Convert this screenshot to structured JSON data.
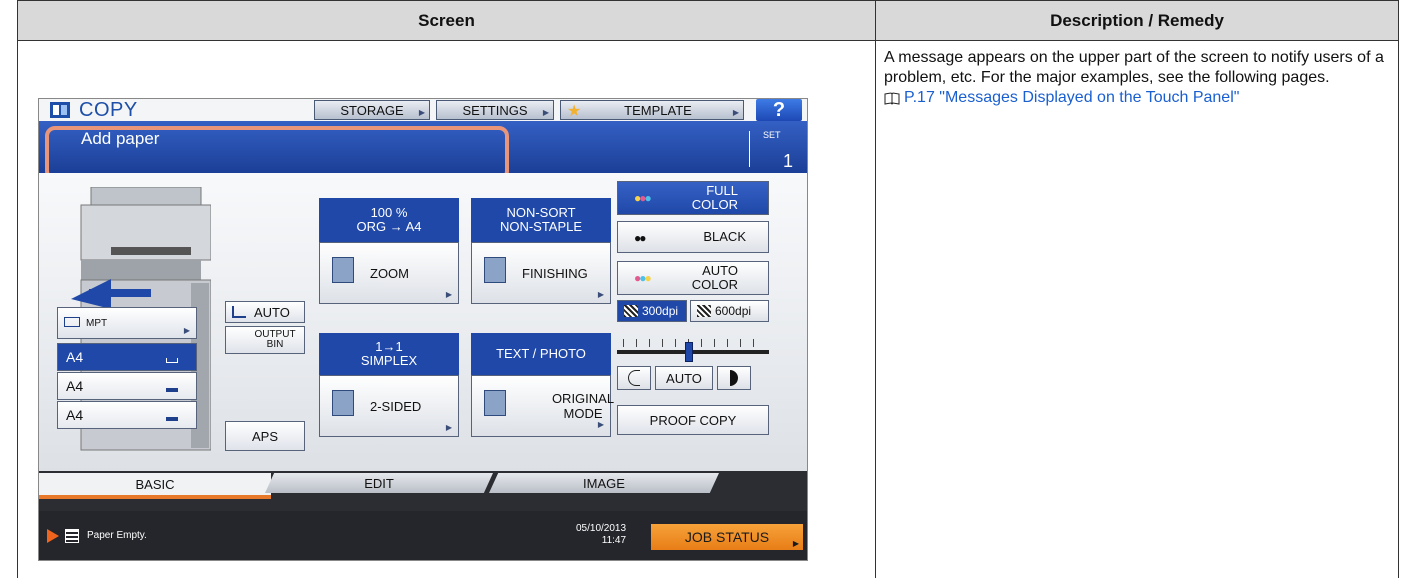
{
  "table": {
    "header_screen": "Screen",
    "header_desc": "Description / Remedy"
  },
  "description": {
    "text": "A message appears on the upper part of the screen to notify users of a problem, etc. For the major examples, see the following pages.",
    "reference": "P.17 \"Messages Displayed on the Touch Panel\"",
    "reference_icon": "book-icon"
  },
  "panel": {
    "app_title": "COPY",
    "top_tabs": [
      "STORAGE",
      "SETTINGS",
      "TEMPLATE"
    ],
    "help_label": "?",
    "message": "Add paper",
    "set_label": "SET",
    "set_value": "1",
    "trays": {
      "mpt": "MPT",
      "a4_1": "A4",
      "a4_2": "A4",
      "a4_3": "A4"
    },
    "auto_label": "AUTO",
    "output_bin_line1": "OUTPUT",
    "output_bin_line2": "BIN",
    "aps_label": "APS",
    "zoom_head_line1": "100 %",
    "zoom_head_line2": "ORG  →  A4",
    "zoom_label": "ZOOM",
    "finishing_head_line1": "NON-SORT",
    "finishing_head_line2": "NON-STAPLE",
    "finishing_label": "FINISHING",
    "sided_head_line1": "1→1",
    "sided_head_line2": "SIMPLEX",
    "sided_label": "2-SIDED",
    "mode_head": "TEXT / PHOTO",
    "mode_label_line1": "ORIGINAL",
    "mode_label_line2": "MODE",
    "full_color_line1": "FULL",
    "full_color_line2": "COLOR",
    "black_label": "BLACK",
    "auto_color_line1": "AUTO",
    "auto_color_line2": "COLOR",
    "dpi_300": "300dpi",
    "dpi_600": "600dpi",
    "density_auto": "AUTO",
    "density_level": 0.47,
    "proof_copy": "PROOF COPY",
    "bottom_tabs": [
      "BASIC",
      "EDIT",
      "IMAGE"
    ],
    "status_message": "Paper Empty.",
    "date": "05/10/2013",
    "time": "11:47",
    "job_status": "JOB STATUS"
  },
  "colors": {
    "accent_blue": "#1f48a8",
    "highlight": "#e8957a",
    "job_status": "#f0901e",
    "link": "#1a5fd0"
  }
}
